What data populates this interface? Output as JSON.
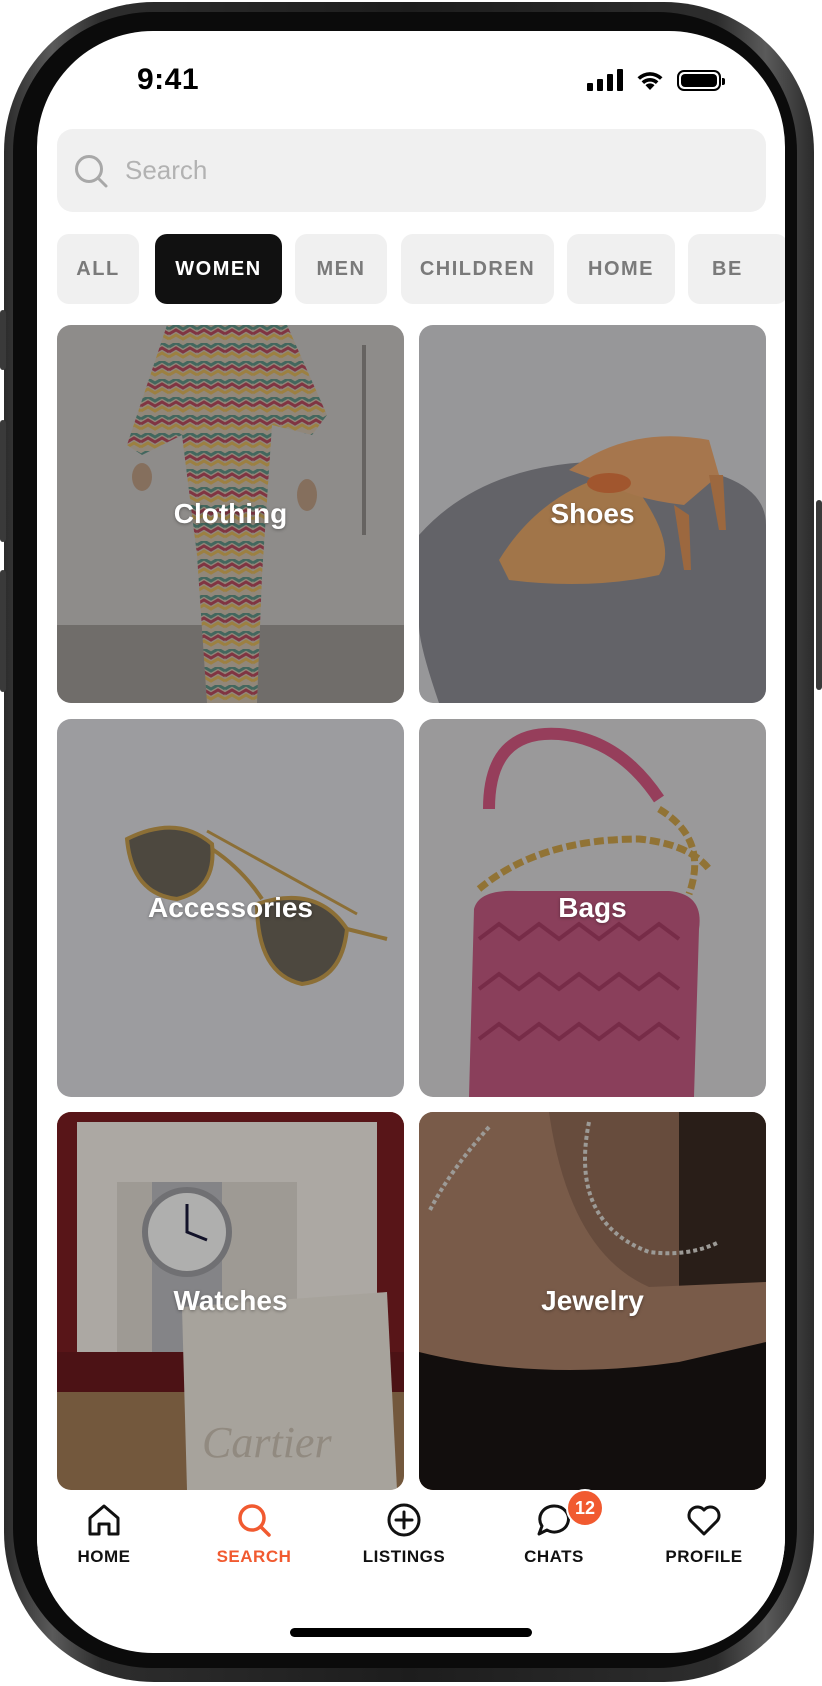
{
  "status_bar": {
    "time": "9:41"
  },
  "search": {
    "placeholder": "Search",
    "value": ""
  },
  "filters": {
    "chips": [
      {
        "label": "ALL",
        "selected": false
      },
      {
        "label": "WOMEN",
        "selected": true
      },
      {
        "label": "MEN",
        "selected": false
      },
      {
        "label": "CHILDREN",
        "selected": false
      },
      {
        "label": "HOME",
        "selected": false
      },
      {
        "label": "BE",
        "selected": false
      }
    ]
  },
  "categories": [
    {
      "label": "Clothing"
    },
    {
      "label": "Shoes"
    },
    {
      "label": "Accessories"
    },
    {
      "label": "Bags"
    },
    {
      "label": "Watches"
    },
    {
      "label": "Jewelry"
    }
  ],
  "tabbar": {
    "active": "SEARCH",
    "active_color": "#f15a30",
    "items": [
      {
        "label": "HOME",
        "icon": "home-icon"
      },
      {
        "label": "SEARCH",
        "icon": "search-icon"
      },
      {
        "label": "LISTINGS",
        "icon": "plus-circle-icon"
      },
      {
        "label": "CHATS",
        "icon": "chat-bubble-icon",
        "badge": "12"
      },
      {
        "label": "PROFILE",
        "icon": "heart-icon"
      }
    ]
  }
}
